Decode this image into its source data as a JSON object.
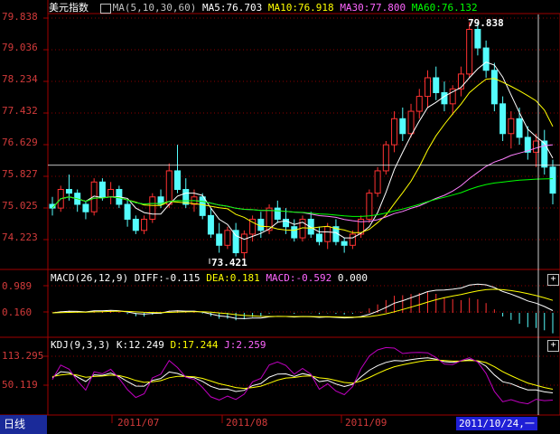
{
  "main_panel": {
    "title": "美元指数",
    "ma_label": "MA(5,10,30,60)",
    "ma5": "MA5:76.703",
    "ma10": "MA10:76.918",
    "ma30": "MA30:77.800",
    "ma60": "MA60:76.132",
    "high_annotation": "79.838",
    "low_annotation": "73.421",
    "y_ticks": [
      "79.838",
      "79.036",
      "78.234",
      "77.432",
      "76.629",
      "75.827",
      "75.025",
      "74.223"
    ]
  },
  "macd_panel": {
    "label": "MACD(26,12,9)",
    "diff": "DIFF:-0.115",
    "dea": "DEA:0.181",
    "macd": "MACD:-0.592",
    "zero": "0.000",
    "y_ticks": [
      "0.989",
      "0.160"
    ]
  },
  "kdj_panel": {
    "label": "KDJ(9,3,3)",
    "k": "K:12.249",
    "d": "D:17.244",
    "j": "J:2.259",
    "y_ticks": [
      "113.295",
      "50.119"
    ]
  },
  "footer": {
    "period": "日线",
    "dates": [
      "2011/07",
      "2011/08",
      "2011/09"
    ],
    "cursor_date": "2011/10/24,一"
  },
  "colors": {
    "up": "#ff3232",
    "down": "#54fcfc",
    "ma5": "#ffffff",
    "ma10": "#ffff00",
    "ma30": "#ff80ff",
    "ma60": "#00ff00",
    "grid": "#8b0000"
  },
  "chart_data": {
    "type": "candlestick",
    "ylim": [
      73.2,
      80.0
    ],
    "candles": [
      [
        74.9,
        75.1,
        74.6,
        74.8
      ],
      [
        74.8,
        75.4,
        74.7,
        75.3
      ],
      [
        75.3,
        75.7,
        75.0,
        75.2
      ],
      [
        75.2,
        75.3,
        74.7,
        74.9
      ],
      [
        74.9,
        75.0,
        74.5,
        74.7
      ],
      [
        74.7,
        75.6,
        74.6,
        75.5
      ],
      [
        75.5,
        75.6,
        75.0,
        75.1
      ],
      [
        75.1,
        75.5,
        74.9,
        75.3
      ],
      [
        75.3,
        75.4,
        74.8,
        74.9
      ],
      [
        74.9,
        75.0,
        74.3,
        74.5
      ],
      [
        74.5,
        74.6,
        74.1,
        74.2
      ],
      [
        74.2,
        74.6,
        74.1,
        74.5
      ],
      [
        74.5,
        75.2,
        74.4,
        75.1
      ],
      [
        75.1,
        75.3,
        74.8,
        74.9
      ],
      [
        74.9,
        76.0,
        74.8,
        75.8
      ],
      [
        75.8,
        76.5,
        75.2,
        75.3
      ],
      [
        75.3,
        75.6,
        74.8,
        74.9
      ],
      [
        74.9,
        75.3,
        74.7,
        75.1
      ],
      [
        75.1,
        75.2,
        74.5,
        74.6
      ],
      [
        74.6,
        74.8,
        74.0,
        74.1
      ],
      [
        74.1,
        74.4,
        73.6,
        73.8
      ],
      [
        73.8,
        74.3,
        73.7,
        74.2
      ],
      [
        74.2,
        74.4,
        73.5,
        73.6
      ],
      [
        73.6,
        74.2,
        73.4,
        74.1
      ],
      [
        74.1,
        74.6,
        73.9,
        74.5
      ],
      [
        74.5,
        74.7,
        74.0,
        74.2
      ],
      [
        74.2,
        74.9,
        74.1,
        74.8
      ],
      [
        74.8,
        75.0,
        74.4,
        74.5
      ],
      [
        74.5,
        74.8,
        74.1,
        74.3
      ],
      [
        74.3,
        74.5,
        73.9,
        74.0
      ],
      [
        74.0,
        74.6,
        73.9,
        74.5
      ],
      [
        74.5,
        74.7,
        74.0,
        74.1
      ],
      [
        74.1,
        74.3,
        73.8,
        73.9
      ],
      [
        73.9,
        74.4,
        73.7,
        74.3
      ],
      [
        74.3,
        74.5,
        73.8,
        73.9
      ],
      [
        73.9,
        74.0,
        73.6,
        73.8
      ],
      [
        73.8,
        74.2,
        73.7,
        74.1
      ],
      [
        74.1,
        74.6,
        74.0,
        74.5
      ],
      [
        74.5,
        75.3,
        74.4,
        75.2
      ],
      [
        75.2,
        75.9,
        75.1,
        75.8
      ],
      [
        75.8,
        76.6,
        75.7,
        76.5
      ],
      [
        76.5,
        77.4,
        76.3,
        77.2
      ],
      [
        77.2,
        77.5,
        76.6,
        76.8
      ],
      [
        76.8,
        77.6,
        76.7,
        77.4
      ],
      [
        77.4,
        78.0,
        77.2,
        77.8
      ],
      [
        77.8,
        78.5,
        77.5,
        78.3
      ],
      [
        78.3,
        78.6,
        77.7,
        77.9
      ],
      [
        77.9,
        78.2,
        77.4,
        77.6
      ],
      [
        77.6,
        78.1,
        77.3,
        78.0
      ],
      [
        78.0,
        78.6,
        77.8,
        78.4
      ],
      [
        78.4,
        79.8,
        78.3,
        79.6
      ],
      [
        79.6,
        79.8,
        78.9,
        79.1
      ],
      [
        79.1,
        79.3,
        78.3,
        78.5
      ],
      [
        78.5,
        78.7,
        77.4,
        77.6
      ],
      [
        77.6,
        77.8,
        76.6,
        76.8
      ],
      [
        76.8,
        77.4,
        76.4,
        77.2
      ],
      [
        77.2,
        77.5,
        76.5,
        76.7
      ],
      [
        76.7,
        77.0,
        76.1,
        76.3
      ],
      [
        76.3,
        76.8,
        75.9,
        76.6
      ],
      [
        76.6,
        76.9,
        75.7,
        75.9
      ],
      [
        75.9,
        76.1,
        74.9,
        75.2
      ]
    ]
  }
}
